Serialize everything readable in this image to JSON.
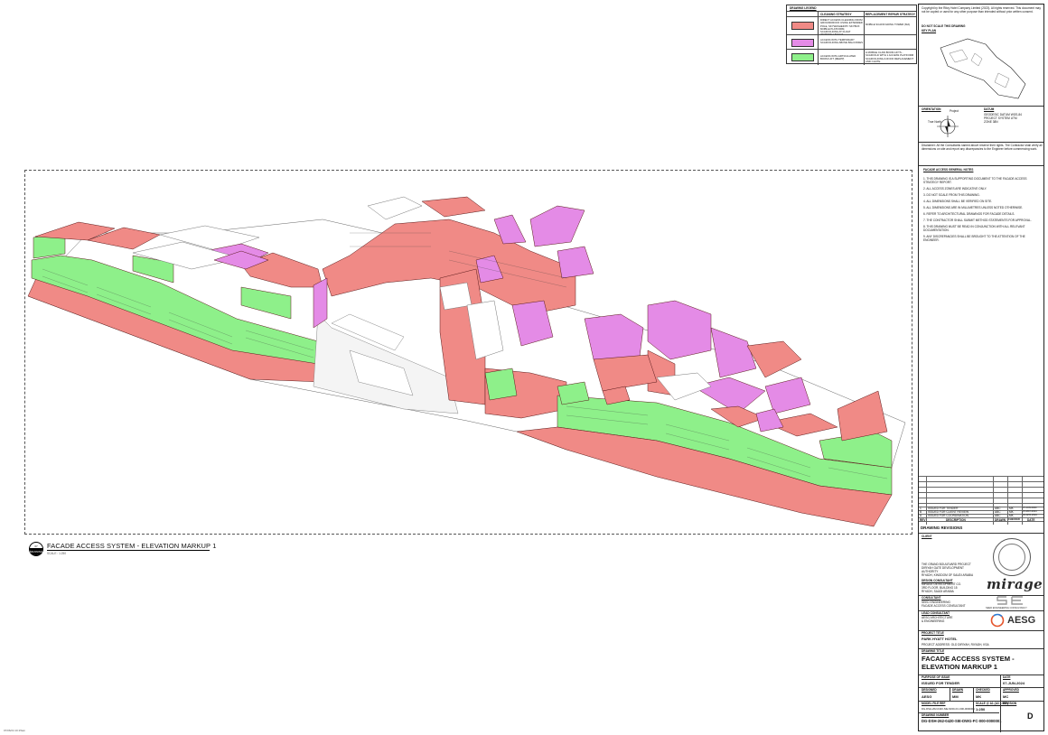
{
  "view": {
    "bubble_top": "07",
    "bubble_bottom": "DRAWING",
    "title": "FACADE ACCESS SYSTEM - ELEVATION MARKUP 1",
    "scale": "SCALE : 1:250"
  },
  "legend": {
    "heading": "DRAWING LEGEND",
    "col_strategy": "CLEANING STRATEGY",
    "col_replacement": "REPLACEMENT REPAIR STRATEGY",
    "rows": [
      {
        "color": "#f08a86",
        "strategy": "DIRECT ACCESS CLEANING FROM GROUND/ROOF USING EXTENDED POLE, SKYWASHER BY SKYBOX MOBILE PLATFORM, SCAFFOLDING AT FLOAT WORKING HEIGHT",
        "replacement": "MOBILE SCAFFOLDING TOWER (MA)"
      },
      {
        "color": "#e48be6",
        "strategy": "ACCESS WITH TEMPORARY SCAFFOLDING ABOVE BALCONIES",
        "replacement": ""
      },
      {
        "color": "#8ef08a",
        "strategy": "ACCESS WITH ARTICULATED BOOM LIFT (MEWP)",
        "replacement": "& MOBILE CLAW BOOM LIFTS - SCAFFOLD WITH 1 ACCESS PLATFORM SCAFFOLDING & ROOF REPLACEMENT AND CHUTE"
      }
    ]
  },
  "title_block": {
    "copyright": "Copyright by the Ritzy Hotel Company Limited (2023). All rights reserved. This document may not be copied or used for any other purpose than intended without prior written consent.",
    "no_scale": "DO NOT SCALE THIS DRAWING",
    "key_plan": "KEY PLAN",
    "orientation": "ORIENTATION",
    "north_project": "Project",
    "north_true": "True North",
    "datum": "DATUM",
    "datum_lines": [
      "GEODESIC DATUM  WGS-84",
      "PROJECT SYSTEM  UTM",
      "ZONE  38N"
    ],
    "disclaimer": "Disclaimer: All the Consultants named above reserve their rights. The Contractor shall verify all dimensions on site and report any discrepancies to the Engineer before commencing work.",
    "notes_heading": "FACADE ACCESS GENERAL NOTES",
    "notes": [
      "1. THIS DRAWING IS A SUPPORTING DOCUMENT TO THE FACADE ACCESS STRATEGY REPORT.",
      "2. ALL ACCESS ZONES ARE INDICATIVE ONLY.",
      "3. DO NOT SCALE FROM THIS DRAWING.",
      "4. ALL DIMENSIONS SHALL BE VERIFIED ON SITE.",
      "5. ALL DIMENSIONS ARE IN MILLIMETRES UNLESS NOTED OTHERWISE.",
      "6. REFER TO ARCHITECTURAL DRAWINGS FOR FACADE DETAILS.",
      "7. THE CONTRACTOR SHALL SUBMIT METHOD STATEMENTS FOR APPROVAL.",
      "8. THIS DRAWING MUST BE READ IN CONJUNCTION WITH ALL RELEVANT DOCUMENTATION.",
      "9. ANY DISCREPANCIES SHALL BE BROUGHT TO THE ATTENTION OF THE ENGINEER."
    ],
    "revisions": [
      {
        "rev": "C",
        "desc": "ISSUED FOR TENDER",
        "by": "ABC",
        "chk": "MK",
        "date": "07-JUN-2024"
      },
      {
        "rev": "B",
        "desc": "ISSUED FOR CLIENT REVIEW",
        "by": "ABC",
        "chk": "MK",
        "date": "15-MAY-2024"
      },
      {
        "rev": "A",
        "desc": "ISSUED FOR COORDINATION",
        "by": "ABC",
        "chk": "MK",
        "date": "02-APR-2024"
      }
    ],
    "rev_header": {
      "rev": "REV",
      "desc": "DESCRIPTION",
      "by": "DRAWN",
      "chk": "CHECKED",
      "date": "DATE"
    },
    "revisions_heading": "DRAWING REVISIONS",
    "client_heading": "CLIENT",
    "client_lines": [
      "THE GRAND BOULEVARD PROJECT",
      "DIRIYAH GATE DEVELOPMENT",
      "AUTHORITY",
      "RIYADH, KINGDOM OF SAUDI ARABIA"
    ],
    "dev_heading": "DESIGN CONSULTANT",
    "dev_lines": [
      "MIRAGE DEVELOPMENT CO.",
      "3RD FLOOR, BUILDING 15",
      "RIYADH, SAUDI ARABIA"
    ],
    "consultant_heading": "CONSULTANT",
    "consultant_lines": [
      "SEED ENGINEERING",
      "FACADE ACCESS CONSULTANT"
    ],
    "contractor_heading": "LEAD CONSULTANT",
    "contractor_lines": [
      "AESG ARCHITECTURE",
      "& ENGINEERING"
    ],
    "mirage": "mirage",
    "se_caption": "SEED ENGINEERING CONSULTANCY",
    "aesg": "AESG",
    "project_heading": "PROJECT TITLE",
    "project_title": "PARK HYATT HOTEL",
    "project_address": "PROJECT ADDRESS: OLD DIRIYAH, RIYADH, KSA",
    "drawing_title_heading": "DRAWING TITLE",
    "drawing_title": "FACADE ACCESS SYSTEM - ELEVATION MARKUP 1",
    "purpose_label": "PURPOSE OF ISSUE",
    "purpose": "ISSUED FOR TENDER",
    "date_label": "DATE",
    "date": "07-JUN-2024",
    "designed_label": "DESIGNED",
    "designed": "AESG",
    "drawn_label": "DRAWN",
    "drawn": "MM",
    "checked_label": "CHECKED",
    "checked": "MK",
    "approved_label": "APPROVED",
    "approved": "MC",
    "model_label": "MODEL FILE REF",
    "model": "DG-DSH-262-0420-SIE-MOD-FC-000-0000001",
    "scale_label": "SCALE @ A1 (A3 1:500)",
    "scale": "1:250",
    "revision_label": "REVISION",
    "number_label": "DRAWING NUMBER",
    "number": "DG-DSH-262-0420-SIE-DWG-FC-000-0000001",
    "revision": "D"
  },
  "footer": "07/06/24  10:15am",
  "colors": {
    "red": "#f08a86",
    "magenta": "#e48be6",
    "green": "#8ef08a",
    "red_stroke": "#8a2020"
  }
}
